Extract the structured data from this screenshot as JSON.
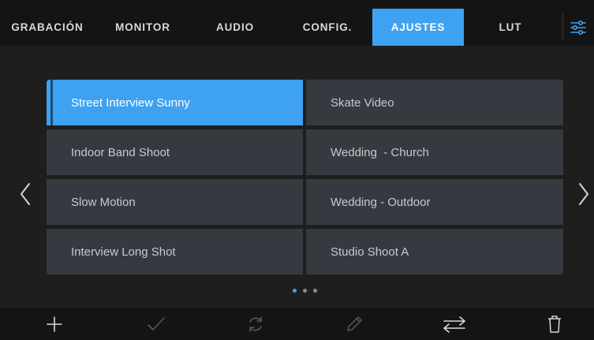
{
  "tabs": [
    {
      "label": "GRABACIÓN",
      "active": false
    },
    {
      "label": "MONITOR",
      "active": false
    },
    {
      "label": "AUDIO",
      "active": false
    },
    {
      "label": "CONFIG.",
      "active": false
    },
    {
      "label": "AJUSTES",
      "active": true
    },
    {
      "label": "LUT",
      "active": false
    }
  ],
  "menu_icon": "sliders-icon",
  "presets": [
    [
      "Street Interview Sunny",
      "Skate Video"
    ],
    [
      "Indoor Band Shoot",
      "Wedding  - Church"
    ],
    [
      "Slow Motion",
      "Wedding - Outdoor"
    ],
    [
      "Interview Long Shot",
      "Studio Shoot A"
    ]
  ],
  "selected_preset": "Street Interview Sunny",
  "pagination": {
    "pages": 3,
    "current": 1
  },
  "toolbar_icons": [
    "plus-icon",
    "checkmark-icon",
    "refresh-icon",
    "pencil-icon",
    "swap-arrows-icon",
    "trash-icon"
  ],
  "colors": {
    "accent": "#3ea1f1",
    "background": "#1e1e1f",
    "bar": "#141415",
    "tile": "#353a40"
  }
}
